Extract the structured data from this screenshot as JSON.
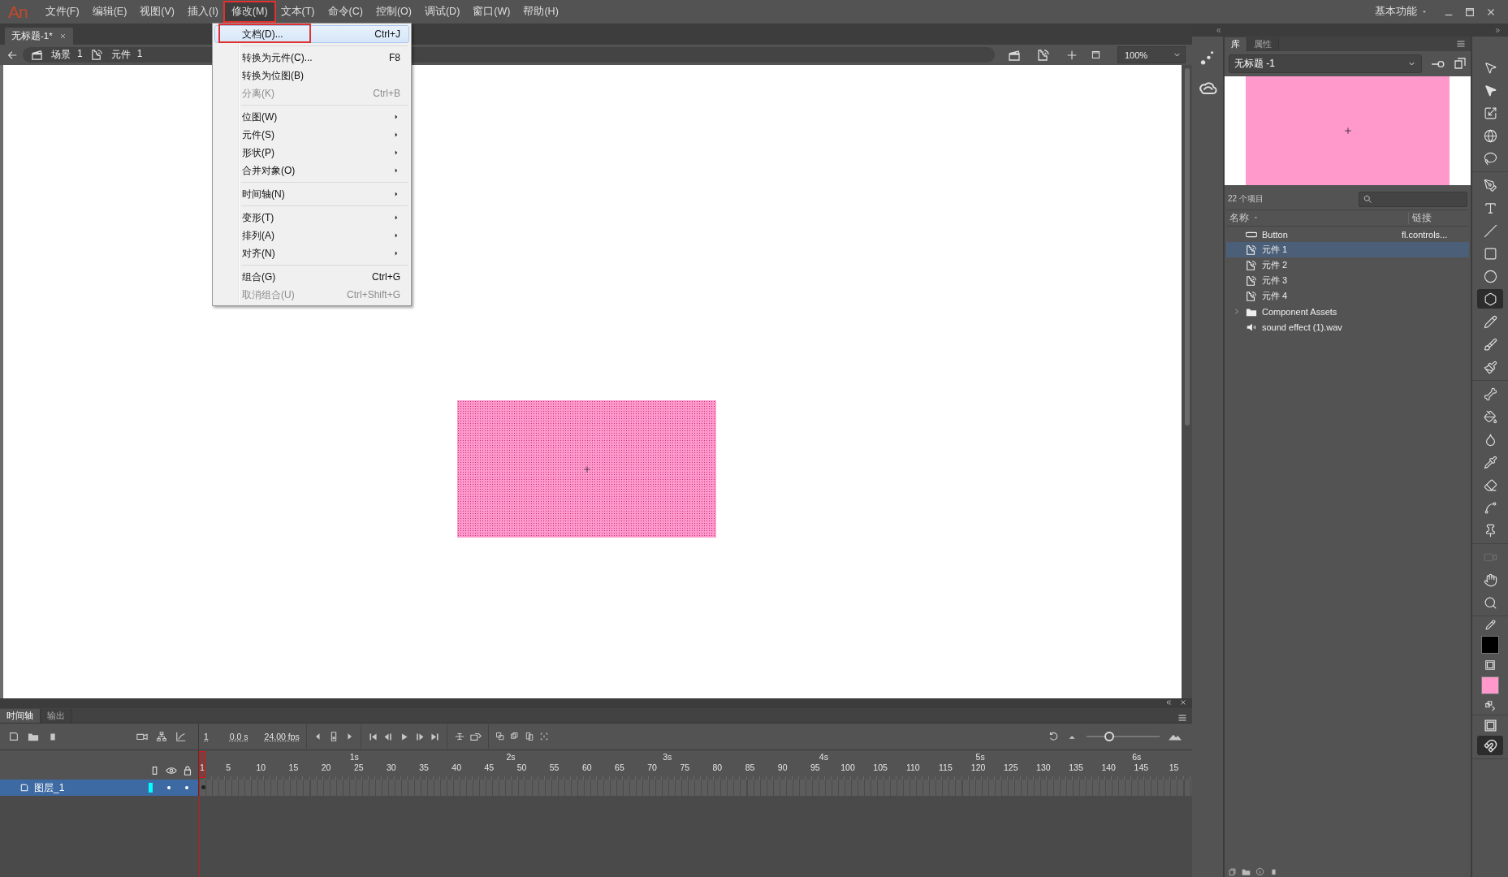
{
  "menu_bar": {
    "logo": "An",
    "items": [
      {
        "label": "文件(F)",
        "selected": false
      },
      {
        "label": "编辑(E)",
        "selected": false
      },
      {
        "label": "视图(V)",
        "selected": false
      },
      {
        "label": "插入(I)",
        "selected": false
      },
      {
        "label": "修改(M)",
        "selected": true
      },
      {
        "label": "文本(T)",
        "selected": false
      },
      {
        "label": "命令(C)",
        "selected": false
      },
      {
        "label": "控制(O)",
        "selected": false
      },
      {
        "label": "调试(D)",
        "selected": false
      },
      {
        "label": "窗口(W)",
        "selected": false
      },
      {
        "label": "帮助(H)",
        "selected": false
      }
    ],
    "workspace": "基本功能"
  },
  "document_tab": {
    "title": "无标题-1*"
  },
  "breadcrumb": [
    {
      "kind": "scene",
      "label": "场景",
      "number": "1"
    },
    {
      "kind": "symbol",
      "label": "元件",
      "number": "1"
    }
  ],
  "zoom": "100%",
  "dropdown": {
    "items": [
      {
        "kind": "item",
        "label": "文档(D)...",
        "shortcut": "Ctrl+J",
        "disabled": false,
        "highlighted": true,
        "submenu": false
      },
      {
        "kind": "separator"
      },
      {
        "kind": "item",
        "label": "转换为元件(C)...",
        "shortcut": "F8",
        "disabled": false,
        "highlighted": false,
        "submenu": false
      },
      {
        "kind": "item",
        "label": "转换为位图(B)",
        "disabled": false,
        "highlighted": false,
        "submenu": false
      },
      {
        "kind": "item",
        "label": "分离(K)",
        "shortcut": "Ctrl+B",
        "disabled": true,
        "highlighted": false,
        "submenu": false
      },
      {
        "kind": "separator"
      },
      {
        "kind": "item",
        "label": "位图(W)",
        "disabled": false,
        "highlighted": false,
        "submenu": true
      },
      {
        "kind": "item",
        "label": "元件(S)",
        "disabled": false,
        "highlighted": false,
        "submenu": true
      },
      {
        "kind": "item",
        "label": "形状(P)",
        "disabled": false,
        "highlighted": false,
        "submenu": true
      },
      {
        "kind": "item",
        "label": "合并对象(O)",
        "disabled": false,
        "highlighted": false,
        "submenu": true
      },
      {
        "kind": "separator"
      },
      {
        "kind": "item",
        "label": "时间轴(N)",
        "disabled": false,
        "highlighted": false,
        "submenu": true
      },
      {
        "kind": "separator"
      },
      {
        "kind": "item",
        "label": "变形(T)",
        "disabled": false,
        "highlighted": false,
        "submenu": true
      },
      {
        "kind": "item",
        "label": "排列(A)",
        "disabled": false,
        "highlighted": false,
        "submenu": true
      },
      {
        "kind": "item",
        "label": "对齐(N)",
        "disabled": false,
        "highlighted": false,
        "submenu": true
      },
      {
        "kind": "separator"
      },
      {
        "kind": "item",
        "label": "组合(G)",
        "shortcut": "Ctrl+G",
        "disabled": false,
        "highlighted": false,
        "submenu": false
      },
      {
        "kind": "item",
        "label": "取消组合(U)",
        "shortcut": "Ctrl+Shift+G",
        "disabled": true,
        "highlighted": false,
        "submenu": false
      }
    ]
  },
  "library": {
    "tabs": [
      {
        "label": "库",
        "selected": true
      },
      {
        "label": "属性",
        "selected": false
      }
    ],
    "document": "无标题 -1",
    "count": "22 个项目",
    "columns": [
      "名称",
      "链接"
    ],
    "items": [
      {
        "kind": "button",
        "name": "Button",
        "linkage": "fl.controls...",
        "selected": false
      },
      {
        "kind": "graphic",
        "name": "元件 1",
        "selected": true
      },
      {
        "kind": "graphic",
        "name": "元件 2",
        "selected": false
      },
      {
        "kind": "graphic",
        "name": "元件 3",
        "selected": false
      },
      {
        "kind": "graphic",
        "name": "元件 4",
        "selected": false
      },
      {
        "kind": "folder",
        "name": "Component Assets",
        "expanded": false,
        "selected": false
      },
      {
        "kind": "sound",
        "name": "sound effect (1).wav",
        "selected": false
      }
    ]
  },
  "timeline": {
    "tabs": [
      {
        "label": "时间轴",
        "selected": true
      },
      {
        "label": "输出",
        "selected": false
      }
    ],
    "frame": "1",
    "time": "0.0 s",
    "fps": "24.00 fps",
    "frame_size": {
      "level": 0.28
    },
    "seconds": [
      "1s",
      "2s",
      "3s",
      "4s",
      "5s",
      "6s"
    ],
    "frame_labels": [
      "1",
      "5",
      "10",
      "15",
      "20",
      "25",
      "30",
      "35",
      "40",
      "45",
      "50",
      "55",
      "60",
      "65",
      "70",
      "75",
      "80",
      "85",
      "90",
      "95",
      "100",
      "105",
      "110",
      "115",
      "120",
      "125",
      "130",
      "135",
      "140",
      "145",
      "15"
    ],
    "layers": [
      {
        "name": "图层_1",
        "selected": true,
        "color": "#00ffff"
      }
    ]
  },
  "tool_groups": [
    {
      "tools": [
        {
          "kind": "selection",
          "selected": false,
          "disabled": false
        },
        {
          "kind": "subselection",
          "selected": false,
          "disabled": false
        },
        {
          "kind": "free_transform",
          "selected": false,
          "disabled": false
        },
        {
          "kind": "rotation_3d",
          "selected": false,
          "disabled": false
        },
        {
          "kind": "lasso",
          "selected": false,
          "disabled": false
        }
      ]
    },
    {
      "tools": [
        {
          "kind": "pen",
          "selected": false,
          "disabled": false
        },
        {
          "kind": "text",
          "selected": false,
          "disabled": false
        },
        {
          "kind": "line",
          "selected": false,
          "disabled": false
        },
        {
          "kind": "rectangle",
          "selected": false,
          "disabled": false
        },
        {
          "kind": "oval",
          "selected": false,
          "disabled": false
        },
        {
          "kind": "polystar",
          "selected": true,
          "disabled": false
        },
        {
          "kind": "pencil",
          "selected": false,
          "disabled": false
        },
        {
          "kind": "paint_brush",
          "selected": false,
          "disabled": false
        },
        {
          "kind": "brush",
          "selected": false,
          "disabled": false
        }
      ]
    },
    {
      "tools": [
        {
          "kind": "bone",
          "selected": false,
          "disabled": false
        },
        {
          "kind": "paint_bucket",
          "selected": false,
          "disabled": false
        },
        {
          "kind": "ink_bottle",
          "selected": false,
          "disabled": false
        },
        {
          "kind": "eyedropper",
          "selected": false,
          "disabled": false
        },
        {
          "kind": "eraser",
          "selected": false,
          "disabled": false
        },
        {
          "kind": "width",
          "selected": false,
          "disabled": false
        },
        {
          "kind": "pin",
          "selected": false,
          "disabled": false
        }
      ]
    },
    {
      "tools": [
        {
          "kind": "camera",
          "selected": false,
          "disabled": true
        },
        {
          "kind": "hand",
          "selected": false,
          "disabled": false
        },
        {
          "kind": "zoom",
          "selected": false,
          "disabled": false
        }
      ]
    }
  ],
  "swatches": [
    {
      "kind": "stroke",
      "color": "#000000"
    },
    {
      "kind": "fill",
      "color": "#ff99cc"
    }
  ]
}
